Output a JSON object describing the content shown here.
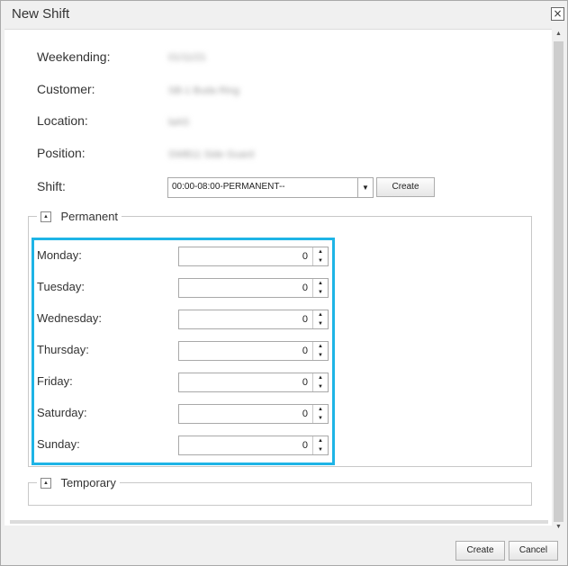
{
  "window": {
    "title": "New Shift",
    "close_glyph": "×"
  },
  "form": {
    "weekending_label": "Weekending:",
    "weekending_value": "01/11/21",
    "customer_label": "Customer:",
    "customer_value": "SB-1 Buda Ring",
    "location_label": "Location:",
    "location_value": "laAS",
    "position_label": "Position:",
    "position_value": "SWB11 Side Guard",
    "shift_label": "Shift:",
    "shift_value": "00:00-08:00-PERMANENT--",
    "shift_create_label": "Create"
  },
  "permanent": {
    "title": "Permanent",
    "days": [
      {
        "label": "Monday:",
        "value": "0"
      },
      {
        "label": "Tuesday:",
        "value": "0"
      },
      {
        "label": "Wednesday:",
        "value": "0"
      },
      {
        "label": "Thursday:",
        "value": "0"
      },
      {
        "label": "Friday:",
        "value": "0"
      },
      {
        "label": "Saturday:",
        "value": "0"
      },
      {
        "label": "Sunday:",
        "value": "0"
      }
    ]
  },
  "temporary": {
    "title": "Temporary"
  },
  "footer": {
    "create_label": "Create",
    "cancel_label": "Cancel"
  },
  "icons": {
    "collapse": "collapse-up-icon",
    "dropdown": "chevron-down-icon",
    "spin_up": "spin-up-icon",
    "spin_down": "spin-down-icon",
    "close": "close-icon"
  },
  "colors": {
    "highlight": "#1eb4e6",
    "dialog_bg": "#f0f0f0"
  }
}
